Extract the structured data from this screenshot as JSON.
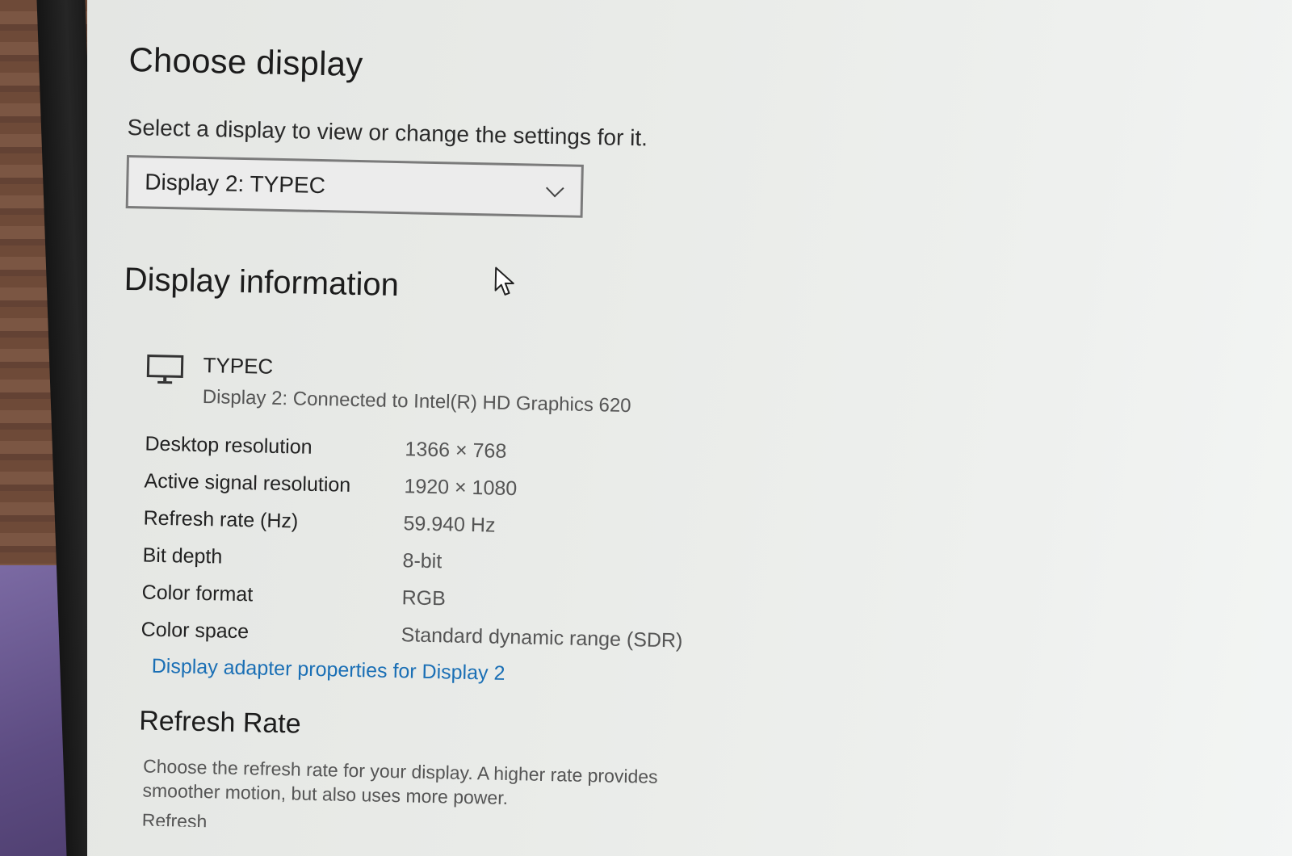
{
  "choose_display": {
    "title": "Choose display",
    "instruction": "Select a display to view or change the settings for it.",
    "selected_display": "Display 2: TYPEC"
  },
  "display_information": {
    "title": "Display information",
    "device_name": "TYPEC",
    "device_description": "Display 2: Connected to Intel(R) HD Graphics 620",
    "rows": [
      {
        "label": "Desktop resolution",
        "value": "1366 × 768"
      },
      {
        "label": "Active signal resolution",
        "value": "1920 × 1080"
      },
      {
        "label": "Refresh rate (Hz)",
        "value": "59.940 Hz"
      },
      {
        "label": "Bit depth",
        "value": "8-bit"
      },
      {
        "label": "Color format",
        "value": "RGB"
      },
      {
        "label": "Color space",
        "value": "Standard dynamic range (SDR)"
      }
    ],
    "adapter_link": "Display adapter properties for Display 2"
  },
  "refresh_rate": {
    "title": "Refresh Rate",
    "description": "Choose the refresh rate for your display. A higher rate provides smoother motion, but also uses more power.",
    "cut_off_label": "Refresh"
  },
  "colors": {
    "link": "#1a6fb5",
    "background": "#e9ebe8"
  }
}
